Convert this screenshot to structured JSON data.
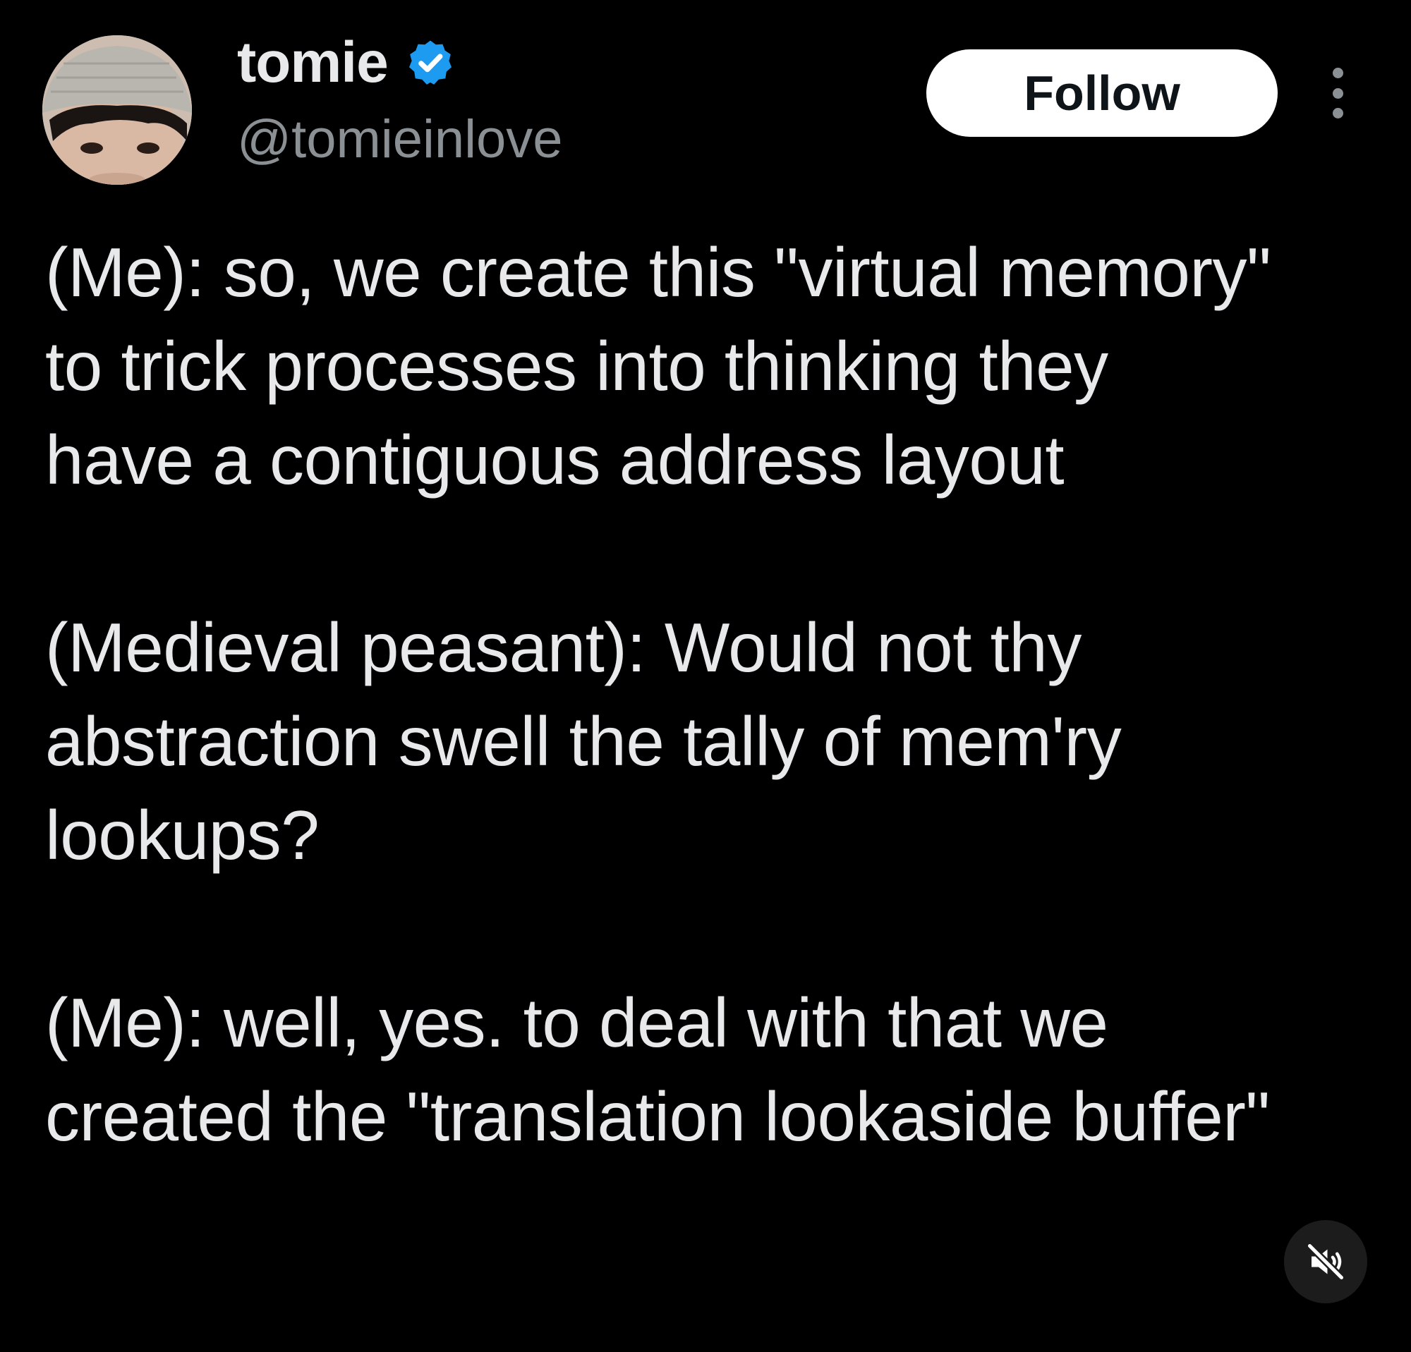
{
  "author": {
    "display_name": "tomie",
    "handle": "@tomieinlove",
    "verified": true,
    "verified_color": "#1d9bf0",
    "avatar": "avatar-photo"
  },
  "actions": {
    "follow_label": "Follow",
    "more_icon": "more-vertical-icon",
    "mute_icon": "speaker-muted-icon"
  },
  "tweet": {
    "paragraphs": [
      "(Me): so, we create this \"virtual memory\" to trick processes into thinking they have a contiguous address layout",
      "(Medieval peasant): Would not thy abstraction swell the tally of mem'ry lookups?",
      "(Me): well, yes. to deal with that we created the \"translation lookaside buffer\""
    ]
  },
  "colors": {
    "background": "#000000",
    "text_primary": "#e7e9ea",
    "text_secondary": "#8b9095",
    "follow_bg": "#ffffff",
    "follow_text": "#0f1419"
  }
}
